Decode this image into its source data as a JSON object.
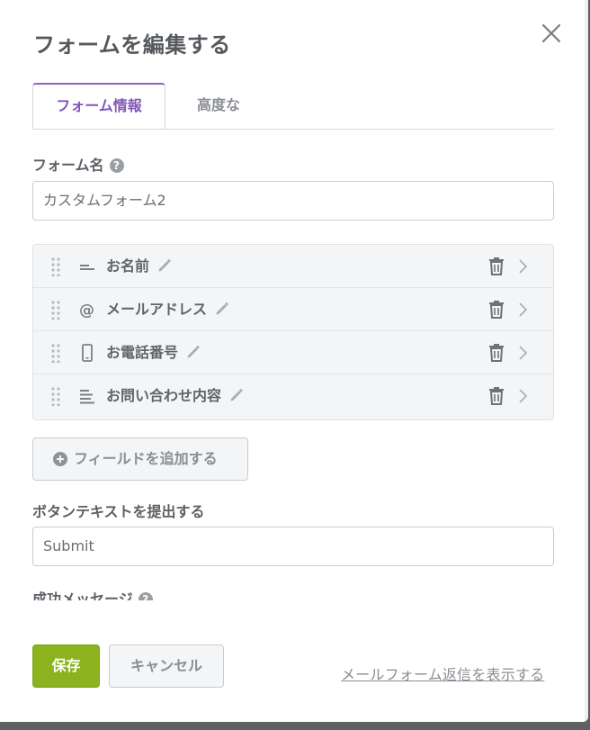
{
  "dialog": {
    "title": "フォームを編集する"
  },
  "tabs": [
    {
      "label": "フォーム情報",
      "active": true
    },
    {
      "label": "高度な",
      "active": false
    }
  ],
  "form_name": {
    "label": "フォーム名",
    "help_icon": "?",
    "value": "カスタムフォーム2"
  },
  "fields": [
    {
      "label": "お名前",
      "icon": "short-text-icon"
    },
    {
      "label": "メールアドレス",
      "icon": "at-sign-icon"
    },
    {
      "label": "お電話番号",
      "icon": "phone-icon"
    },
    {
      "label": "お問い合わせ内容",
      "icon": "paragraph-icon"
    }
  ],
  "add_field": {
    "label": "フィールドを追加する"
  },
  "button_text": {
    "label": "ボタンテキストを提出する",
    "value": "Submit"
  },
  "success_message": {
    "label": "成功メッセージ"
  },
  "footer": {
    "save_label": "保存",
    "cancel_label": "キャンセル",
    "preview_link": "メールフォーム返信を表示する"
  },
  "colors": {
    "accent_purple": "#8b64c4",
    "save_green": "#8cb21e",
    "overlay": "#5f6064"
  }
}
